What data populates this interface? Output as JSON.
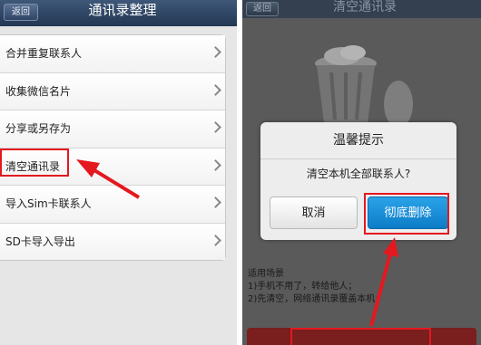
{
  "colors": {
    "annotation_red": "#e4181f",
    "titlebar": "#223753",
    "primary_button": "#0d7cc7"
  },
  "left_screen": {
    "back_label": "返回",
    "title": "通讯录整理",
    "menu_items": [
      {
        "label": "合并重复联系人",
        "icon": "chevron-right-icon"
      },
      {
        "label": "收集微信名片",
        "icon": "chevron-right-icon"
      },
      {
        "label": "分享或另存为",
        "icon": "chevron-right-icon"
      },
      {
        "label": "清空通讯录",
        "icon": "chevron-right-icon"
      },
      {
        "label": "导入Sim卡联系人",
        "icon": "chevron-right-icon"
      },
      {
        "label": "SD卡导入导出",
        "icon": "chevron-right-icon"
      }
    ]
  },
  "right_screen": {
    "back_label": "返回",
    "title": "清空通讯录",
    "dialog": {
      "title": "温馨提示",
      "message": "清空本机全部联系人?",
      "cancel_label": "取消",
      "confirm_label": "彻底删除"
    },
    "scenario": {
      "heading": "适用场景",
      "line1": "1)手机不用了，转给他人；",
      "line2": "2)先清空，网络通讯录覆盖本机；"
    }
  }
}
